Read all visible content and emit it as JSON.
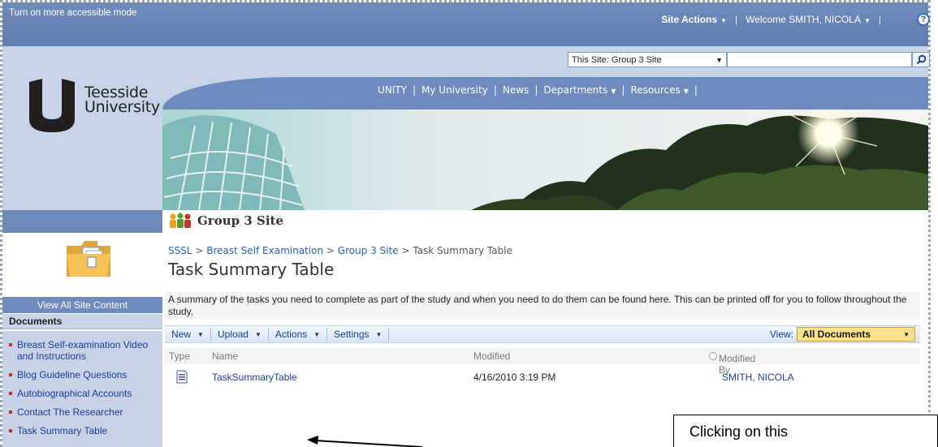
{
  "topbar": {
    "accessible_mode": "Turn on more accessible mode",
    "site_actions": "Site Actions",
    "welcome": "Welcome SMITH, NICOLA",
    "help": "?"
  },
  "search": {
    "scope": "This Site: Group 3 Site",
    "placeholder": ""
  },
  "logo": {
    "line1": "Teesside",
    "line2": "University"
  },
  "nav": {
    "items": [
      "UNITY",
      "My University",
      "News",
      "Departments",
      "Resources"
    ]
  },
  "sidebar": {
    "view_all": "View All Site Content",
    "section": "Documents",
    "items": [
      "Breast Self-examination Video and Instructions",
      "Blog Guideline Questions",
      "Autobiographical Accounts",
      "Contact The Researcher",
      "Task Summary Table"
    ]
  },
  "site": {
    "title": "Group 3 Site"
  },
  "breadcrumb": {
    "items": [
      "SSSL",
      "Breast Self Examination",
      "Group 3 Site",
      "Task Summary Table"
    ],
    "sep": ">"
  },
  "page": {
    "title": "Task Summary Table",
    "description": "A summary of the tasks you need to complete as part of the study and when you need to do them can be found here. This can be printed off for you to follow throughout the study."
  },
  "toolbar": {
    "new": "New",
    "upload": "Upload",
    "actions": "Actions",
    "settings": "Settings",
    "view_label": "View:",
    "view_value": "All Documents"
  },
  "table": {
    "headers": [
      "Type",
      "Name",
      "Modified",
      "Modified By"
    ],
    "rows": [
      {
        "name": "TaskSummaryTable",
        "modified": "4/16/2010 3:19 PM",
        "modified_by": "SMITH, NICOLA"
      }
    ]
  },
  "annotation": {
    "callout": "Clicking on this"
  },
  "colors": {
    "topbar": "#6d89b8",
    "header_bg": "#c9d3e7",
    "link": "#1a3d96",
    "view_selected": "#f9e08a"
  }
}
